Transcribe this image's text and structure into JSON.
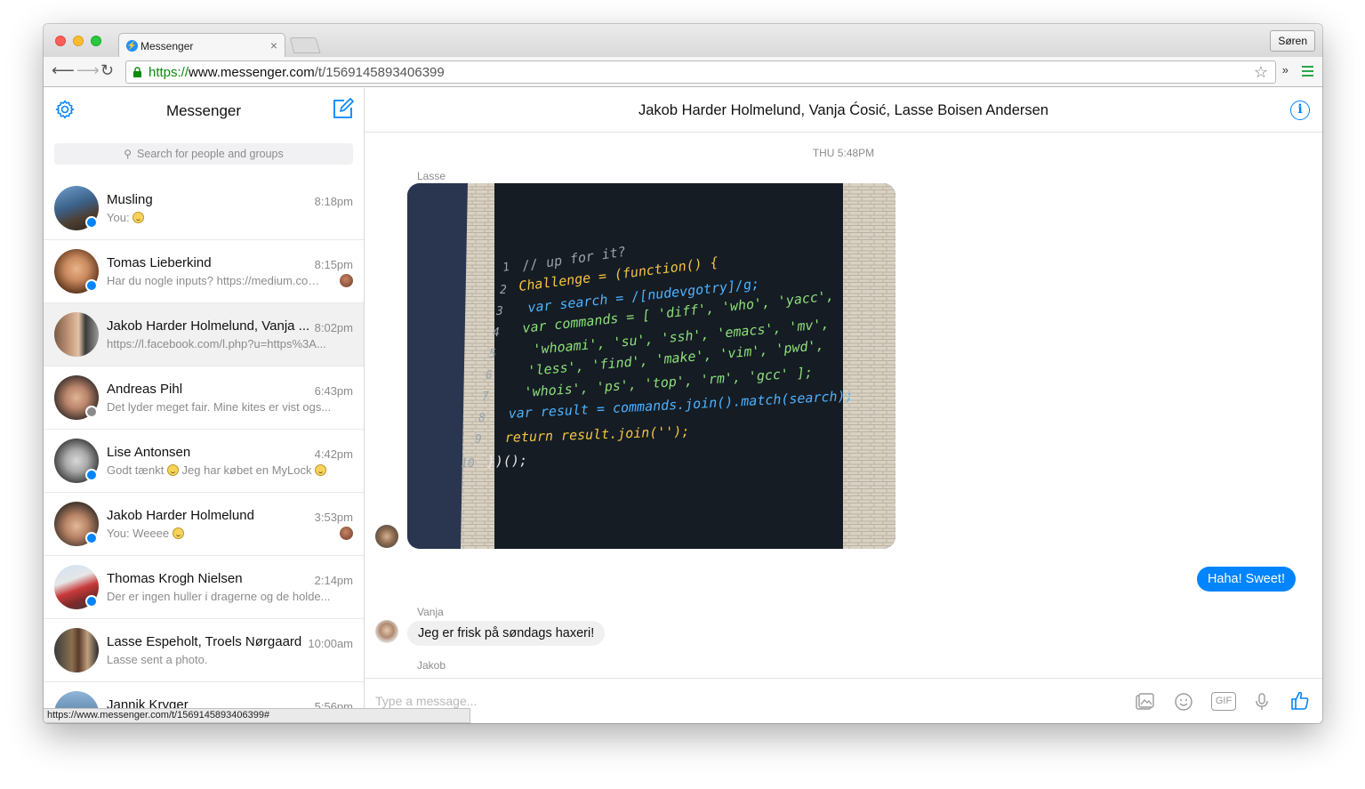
{
  "browser": {
    "tab_title": "Messenger",
    "tab_close": "×",
    "user_button": "Søren",
    "url_scheme": "https://",
    "url_host": "www.messenger.com",
    "url_path": "/t/1569145893406399",
    "status_url": "https://www.messenger.com/t/1569145893406399#",
    "extensions_label": "»"
  },
  "sidebar": {
    "title": "Messenger",
    "search_placeholder": "Search for people and groups",
    "conversations": [
      {
        "name": "Musling",
        "time": "8:18pm",
        "snippet": "You: ",
        "emoji": true
      },
      {
        "name": "Tomas Lieberkind",
        "time": "8:15pm",
        "snippet": "Har du nogle inputs? https://medium.com...",
        "seen": true
      },
      {
        "name": "Jakob Harder Holmelund, Vanja ...",
        "time": "8:02pm",
        "snippet": "https://l.facebook.com/l.php?u=https%3A..."
      },
      {
        "name": "Andreas Pihl",
        "time": "6:43pm",
        "snippet": "Det lyder meget fair. Mine kites er vist ogs..."
      },
      {
        "name": "Lise Antonsen",
        "time": "4:42pm",
        "snippet_a": "Godt tænkt ",
        "snippet_b": " Jeg har købet en MyLock "
      },
      {
        "name": "Jakob Harder Holmelund",
        "time": "3:53pm",
        "snippet": "You: Weeee ",
        "emoji": true,
        "seen": true
      },
      {
        "name": "Thomas Krogh Nielsen",
        "time": "2:14pm",
        "snippet": "Der er ingen huller i dragerne og de holde..."
      },
      {
        "name": "Lasse Espeholt, Troels Nørgaard",
        "time": "10:00am",
        "snippet": "Lasse sent a photo."
      },
      {
        "name": "Jannik Kryger",
        "time": "5:56pm"
      }
    ]
  },
  "thread": {
    "title": "Jakob Harder Holmelund, Vanja Ćosić, Lasse Boisen Andersen",
    "divider": "THU 5:48PM",
    "sender_lasse": "Lasse",
    "my_message": "Haha! Sweet!",
    "sender_vanja": "Vanja",
    "vanja_message": "Jeg er frisk på søndags haxeri!",
    "sender_jakob": "Jakob",
    "composer_placeholder": "Type a message...",
    "composer_gif": "GIF"
  },
  "photo_code": [
    "// up for it?",
    "Challenge = (function() {",
    "var search = /[nudevgotry]/g;",
    "var commands = [ 'diff', 'who', 'yacc',",
    "'whoami', 'su', 'ssh', 'emacs', 'mv',",
    "'less', 'find', 'make', 'vim', 'pwd',",
    "'whois', 'ps', 'top', 'rm', 'gcc' ];",
    "var result = commands.join().match(search);",
    "return result.join('');",
    "})();"
  ],
  "colors": {
    "accent": "#0084ff",
    "bubble_me": "#0084ff",
    "bubble_them": "#f1f0f0",
    "code_keyword": "#f5c542",
    "code_var": "#4fb3ff",
    "code_string": "#8ee07a"
  }
}
